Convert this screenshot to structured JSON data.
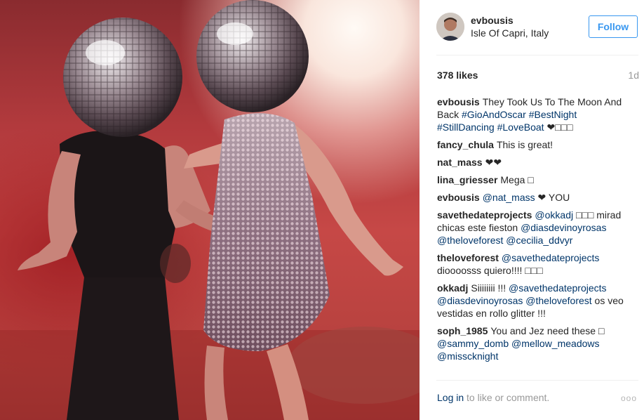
{
  "post": {
    "username": "evbousis",
    "location": "Isle Of Capri, Italy",
    "follow_label": "Follow",
    "likes": "378 likes",
    "time_ago": "1d",
    "avatar_icon": "avatar-icon"
  },
  "comments": [
    {
      "user": "evbousis",
      "parts": [
        {
          "t": "They Took Us To The Moon And Back ",
          "k": "text"
        },
        {
          "t": "#GioAndOscar",
          "k": "lnk"
        },
        {
          "t": " ",
          "k": "text"
        },
        {
          "t": "#BestNight",
          "k": "lnk"
        },
        {
          "t": " ",
          "k": "text"
        },
        {
          "t": "#StillDancing",
          "k": "lnk"
        },
        {
          "t": " ",
          "k": "text"
        },
        {
          "t": "#LoveBoat",
          "k": "lnk"
        },
        {
          "t": " ❤□□□",
          "k": "text"
        }
      ]
    },
    {
      "user": "fancy_chula",
      "parts": [
        {
          "t": "This is great!",
          "k": "text"
        }
      ]
    },
    {
      "user": "nat_mass",
      "parts": [
        {
          "t": "❤❤",
          "k": "text"
        }
      ]
    },
    {
      "user": "lina_griesser",
      "parts": [
        {
          "t": "Mega □",
          "k": "text"
        }
      ]
    },
    {
      "user": "evbousis",
      "parts": [
        {
          "t": "@nat_mass",
          "k": "lnk"
        },
        {
          "t": " ❤ YOU",
          "k": "text"
        }
      ]
    },
    {
      "user": "savethedateprojects",
      "parts": [
        {
          "t": "@okkadj",
          "k": "lnk"
        },
        {
          "t": " □□□ mirad chicas este fieston ",
          "k": "text"
        },
        {
          "t": "@diasdevinoyrosas",
          "k": "lnk"
        },
        {
          "t": " ",
          "k": "text"
        },
        {
          "t": "@theloveforest",
          "k": "lnk"
        },
        {
          "t": " ",
          "k": "text"
        },
        {
          "t": "@cecilia_ddvyr",
          "k": "lnk"
        }
      ]
    },
    {
      "user": "theloveforest",
      "parts": [
        {
          "t": "@savethedateprojects",
          "k": "lnk"
        },
        {
          "t": " dioooosss quiero!!!! □□□",
          "k": "text"
        }
      ]
    },
    {
      "user": "okkadj",
      "parts": [
        {
          "t": "Siiiiiiii !!! ",
          "k": "text"
        },
        {
          "t": "@savethedateprojects",
          "k": "lnk"
        },
        {
          "t": " ",
          "k": "text"
        },
        {
          "t": "@diasdevinoyrosas",
          "k": "lnk"
        },
        {
          "t": " ",
          "k": "text"
        },
        {
          "t": "@theloveforest",
          "k": "lnk"
        },
        {
          "t": " os veo vestidas en rollo glitter !!!",
          "k": "text"
        }
      ]
    },
    {
      "user": "soph_1985",
      "parts": [
        {
          "t": "You and Jez need these □ ",
          "k": "text"
        },
        {
          "t": "@sammy_domb",
          "k": "lnk"
        },
        {
          "t": " ",
          "k": "text"
        },
        {
          "t": "@mellow_meadows",
          "k": "lnk"
        },
        {
          "t": " ",
          "k": "text"
        },
        {
          "t": "@misscknight",
          "k": "lnk"
        }
      ]
    }
  ],
  "footer": {
    "login_link": "Log in",
    "login_suffix": " to like or comment.",
    "more_label": "ooo"
  }
}
